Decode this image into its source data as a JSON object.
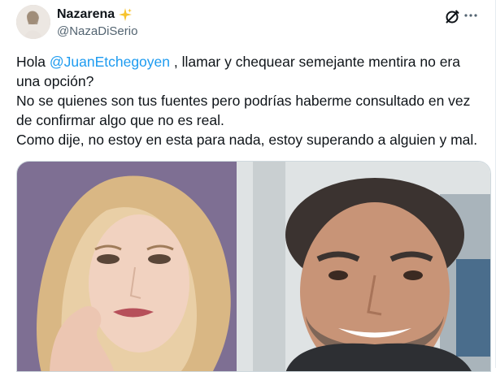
{
  "author": {
    "name": "Nazarena",
    "handle": "@NazaDiSerio",
    "name_emoji_icon": "sparkles-icon",
    "avatar_icon": "user-avatar"
  },
  "actions": {
    "grok_icon": "grok-icon",
    "more_icon": "more-options-icon"
  },
  "tweet": {
    "line1_prefix": "Hola ",
    "mention": "@JuanEtchegoyen",
    "line1_suffix": " , llamar y chequear semejante mentira no era una opción?",
    "line2": "No se quienes son tus fuentes pero podrías haberme consultado en vez de confirmar algo que no es real.",
    "line3": "Como dije, no estoy en esta para nada, estoy superando a alguien y mal."
  },
  "media": {
    "type": "photo",
    "description_icon": "photo-collage"
  },
  "colors": {
    "text": "#0f1419",
    "secondary": "#536471",
    "link": "#1d9bf0",
    "border": "#cfd9de"
  }
}
